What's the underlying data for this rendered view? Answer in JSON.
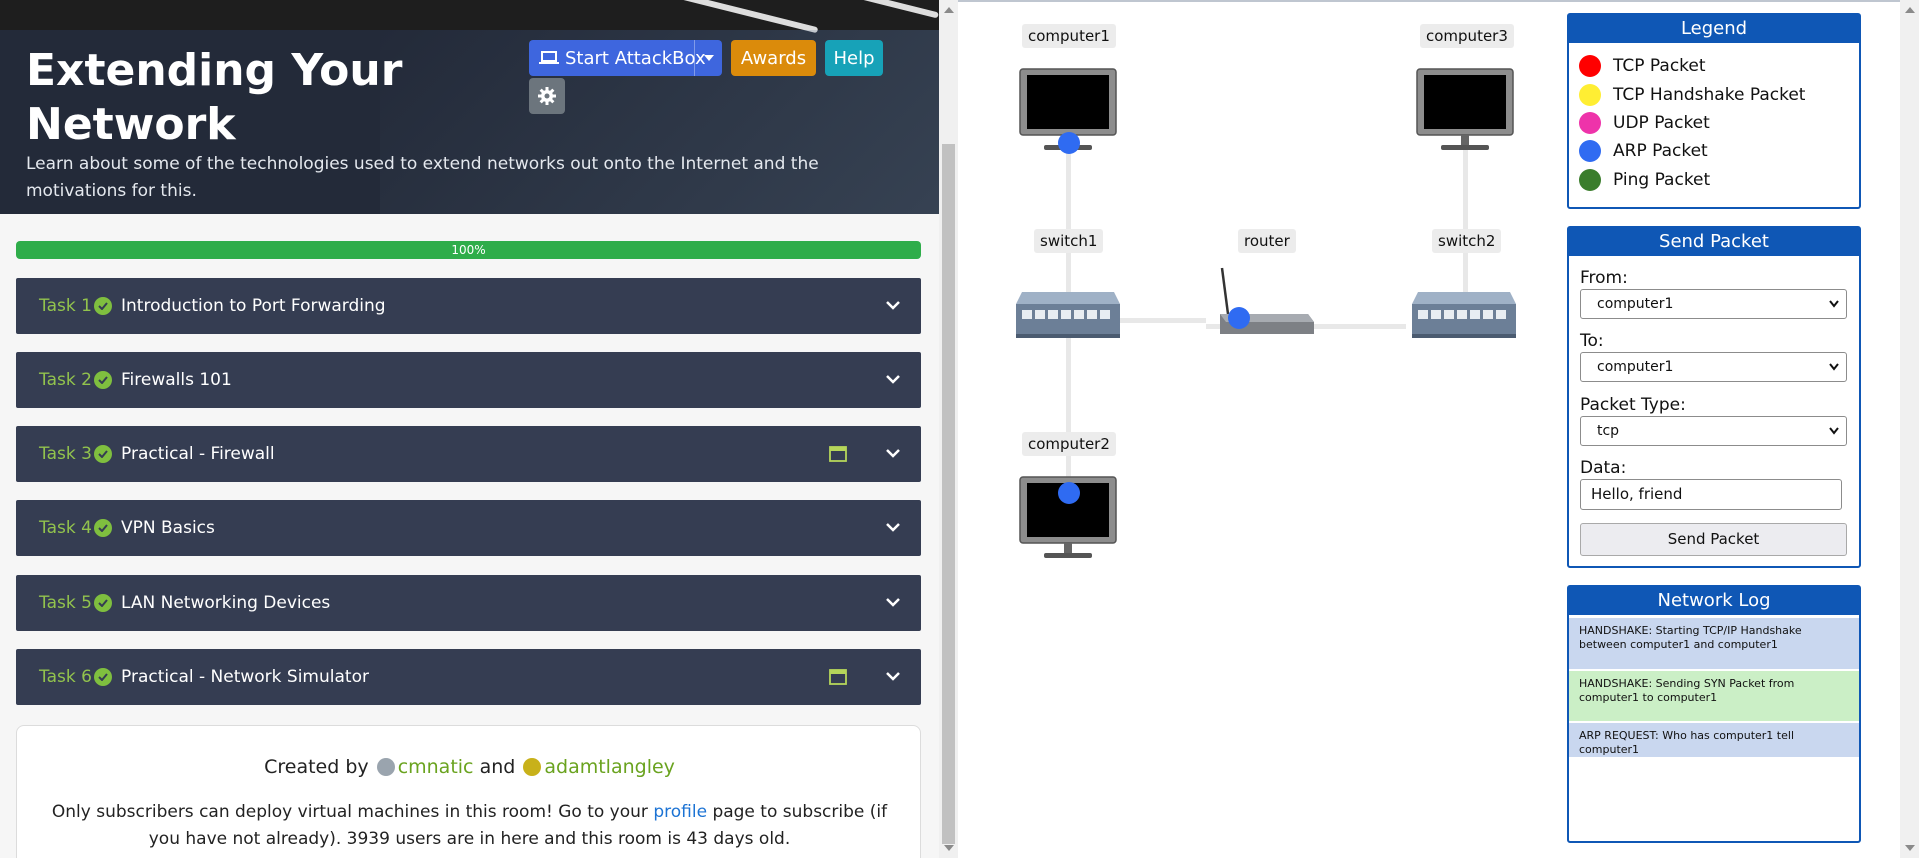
{
  "room": {
    "title": "Extending Your Network",
    "description": "Learn about some of the technologies used to extend networks out onto the Internet and the motivations for this."
  },
  "header_buttons": {
    "attackbox": "Start AttackBox",
    "awards": "Awards",
    "help": "Help"
  },
  "progress": {
    "label": "100%",
    "value": 100
  },
  "tasks": [
    {
      "num": "Task 1",
      "name": "Introduction to Port Forwarding",
      "has_calendar": false
    },
    {
      "num": "Task 2",
      "name": "Firewalls 101",
      "has_calendar": false
    },
    {
      "num": "Task 3",
      "name": "Practical - Firewall",
      "has_calendar": true
    },
    {
      "num": "Task 4",
      "name": "VPN Basics",
      "has_calendar": false
    },
    {
      "num": "Task 5",
      "name": "LAN Networking Devices",
      "has_calendar": false
    },
    {
      "num": "Task 6",
      "name": "Practical - Network Simulator",
      "has_calendar": true
    }
  ],
  "credits": {
    "prefix": "Created by",
    "author1": "cmnatic",
    "joiner": "and",
    "author2": "adamtlangley"
  },
  "notice": {
    "part1": "Only subscribers can deploy virtual machines in this room! Go to your",
    "link": "profile",
    "part2": "page to subscribe (if you have not already). 3939 users are in here and this room is 43 days old."
  },
  "network": {
    "nodes": {
      "computer1": "computer1",
      "computer2": "computer2",
      "computer3": "computer3",
      "switch1": "switch1",
      "switch2": "switch2",
      "router": "router"
    }
  },
  "legend": {
    "title": "Legend",
    "items": [
      {
        "label": "TCP Packet",
        "color": "#ff0000"
      },
      {
        "label": "TCP Handshake Packet",
        "color": "#ffee33"
      },
      {
        "label": "UDP Packet",
        "color": "#ee33aa"
      },
      {
        "label": "ARP Packet",
        "color": "#2f6bf2"
      },
      {
        "label": "Ping Packet",
        "color": "#3a7d2c"
      }
    ]
  },
  "send_packet": {
    "title": "Send Packet",
    "from_label": "From:",
    "from_value": "computer1",
    "to_label": "To:",
    "to_value": "computer1",
    "type_label": "Packet Type:",
    "type_value": "tcp",
    "data_label": "Data:",
    "data_value": "Hello, friend",
    "button": "Send Packet"
  },
  "network_log": {
    "title": "Network Log",
    "entries": [
      {
        "text": "HANDSHAKE: Starting TCP/IP Handshake between computer1 and computer1",
        "bg": "#c9d7ef"
      },
      {
        "text": "HANDSHAKE: Sending SYN Packet from computer1 to computer1",
        "bg": "#cbefc6"
      },
      {
        "text": "ARP REQUEST: Who has computer1 tell computer1",
        "bg": "#c9d7ef"
      }
    ]
  }
}
